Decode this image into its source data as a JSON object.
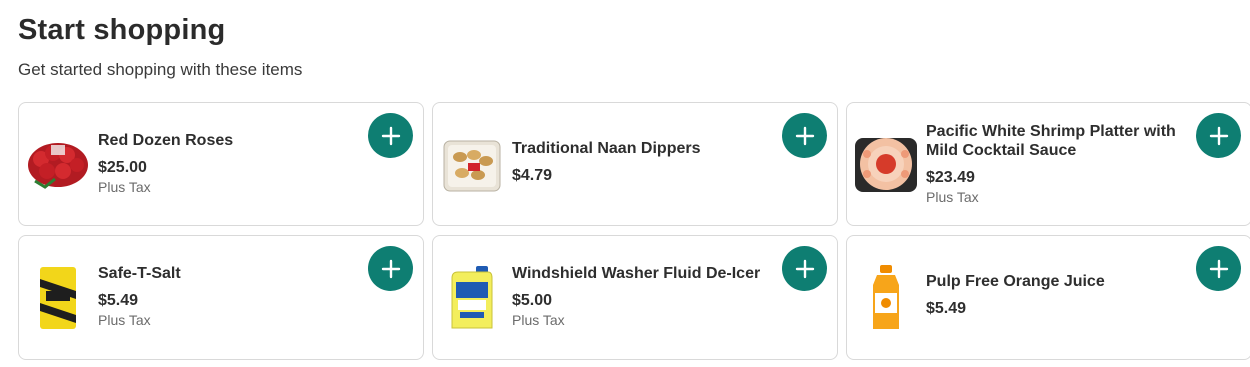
{
  "section": {
    "title": "Start shopping",
    "subtitle": "Get started shopping with these items"
  },
  "colors": {
    "accent": "#0e7e72"
  },
  "products": [
    {
      "name": "Red Dozen Roses",
      "price": "$25.00",
      "tax_note": "Plus Tax",
      "image_icon": "roses-bouquet-icon"
    },
    {
      "name": "Traditional Naan Dippers",
      "price": "$4.79",
      "tax_note": "",
      "image_icon": "naan-container-icon"
    },
    {
      "name": "Pacific White Shrimp Platter with Mild Cocktail Sauce",
      "price": "$23.49",
      "tax_note": "Plus Tax",
      "image_icon": "shrimp-platter-icon"
    },
    {
      "name": "Safe-T-Salt",
      "price": "$5.49",
      "tax_note": "Plus Tax",
      "image_icon": "salt-bag-icon"
    },
    {
      "name": "Windshield Washer Fluid De-Icer",
      "price": "$5.00",
      "tax_note": "Plus Tax",
      "image_icon": "washer-fluid-jug-icon"
    },
    {
      "name": "Pulp Free Orange Juice",
      "price": "$5.49",
      "tax_note": "",
      "image_icon": "orange-juice-bottle-icon"
    }
  ],
  "add_button_icon": "plus-icon"
}
